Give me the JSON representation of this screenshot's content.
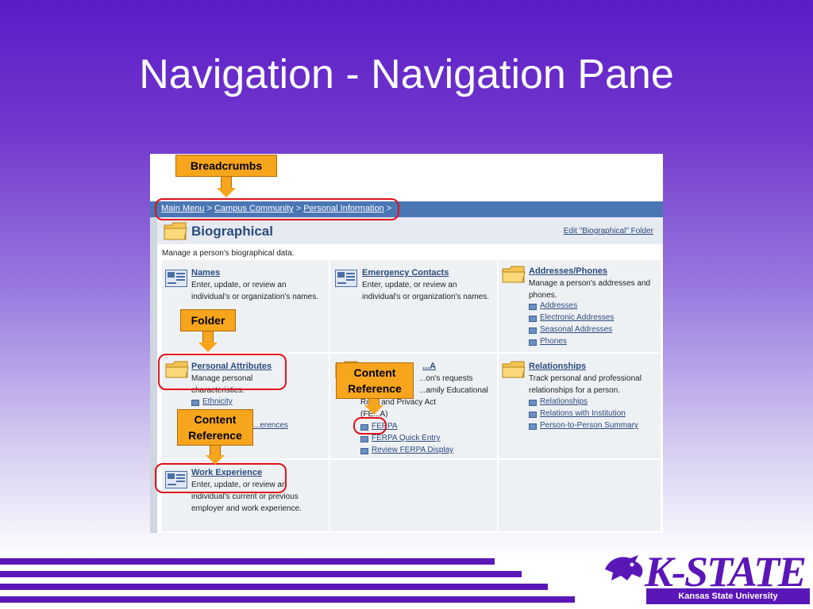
{
  "slide": {
    "title": "Navigation - Navigation Pane"
  },
  "breadcrumb": {
    "items": [
      "Main Menu",
      "Campus Community",
      "Personal Information"
    ],
    "separator": ">"
  },
  "page": {
    "title": "Biographical",
    "edit_link": "Edit \"Biographical\" Folder",
    "description": "Manage a person's biographical data."
  },
  "cells": {
    "names": {
      "title": "Names",
      "text": "Enter, update, or review an individual's or organization's names."
    },
    "emergency": {
      "title": "Emergency Contacts",
      "text": "Enter, update, or review an individual's or organization's names."
    },
    "addresses": {
      "title": "Addresses/Phones",
      "text": "Manage a person's addresses and phones.",
      "links": [
        "Addresses",
        "Electronic Addresses",
        "Seasonal Addresses",
        "Phones"
      ]
    },
    "attributes": {
      "title": "Personal Attributes",
      "text": "Manage personal characteristics.",
      "links": [
        "Ethnicity",
        "...erences"
      ]
    },
    "ferpa": {
      "title": "...A",
      "text_lines": [
        "...on's requests",
        "...amily Educational",
        "Rig... and Privacy Act",
        "(FE...A)"
      ],
      "links": [
        "FERPA",
        "FERPA Quick Entry",
        "Review FERPA Display"
      ]
    },
    "relationships": {
      "title": "Relationships",
      "text": "Track personal and professional relationships for a person.",
      "links": [
        "Relationships",
        "Relations with Institution",
        "Person-to-Person Summary"
      ]
    },
    "work": {
      "title": "Work Experience",
      "text": "Enter, update, or review an individual's current or previous employer and work experience."
    }
  },
  "callouts": {
    "breadcrumbs": "Breadcrumbs",
    "folder": "Folder",
    "content_ref_1": "Content\nReference",
    "content_ref_2": "Content\nReference"
  },
  "branding": {
    "logo": "K-STATE",
    "university": "Kansas State University"
  },
  "colors": {
    "slide_purple": "#5b16b8",
    "callout_orange": "#f7a51d",
    "ring_red": "#e0101a",
    "breadcrumb_bar": "#4a76b4"
  }
}
